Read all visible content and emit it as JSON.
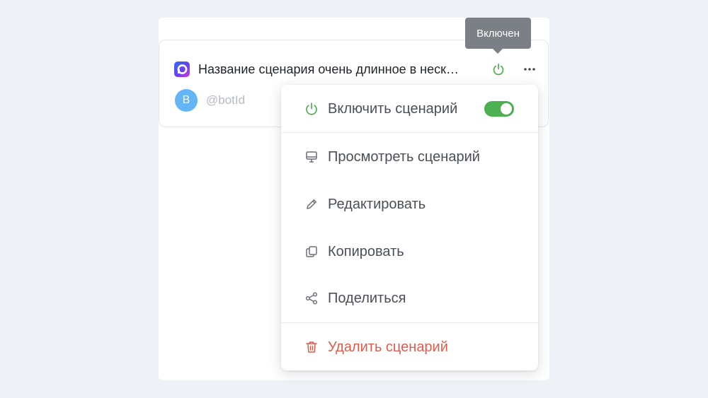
{
  "card": {
    "title": "Название сценария очень длинное в неск…",
    "avatar_letter": "B",
    "bot_id": "@botId"
  },
  "tooltip": {
    "text": "Включен"
  },
  "menu": {
    "items": [
      {
        "label": "Включить сценарий",
        "icon": "power-icon",
        "toggle_on": true
      },
      {
        "label": "Просмотреть сценарий",
        "icon": "monitor-icon"
      },
      {
        "label": "Редактировать",
        "icon": "pencil-icon"
      },
      {
        "label": "Копировать",
        "icon": "copy-icon"
      },
      {
        "label": "Поделиться",
        "icon": "share-icon"
      },
      {
        "label": "Удалить сценарий",
        "icon": "trash-icon",
        "danger": true
      }
    ]
  },
  "colors": {
    "accent_green": "#4caf50",
    "danger_red": "#e25b4a",
    "avatar_blue": "#64b5f6",
    "tooltip_bg": "#7b7f86"
  }
}
